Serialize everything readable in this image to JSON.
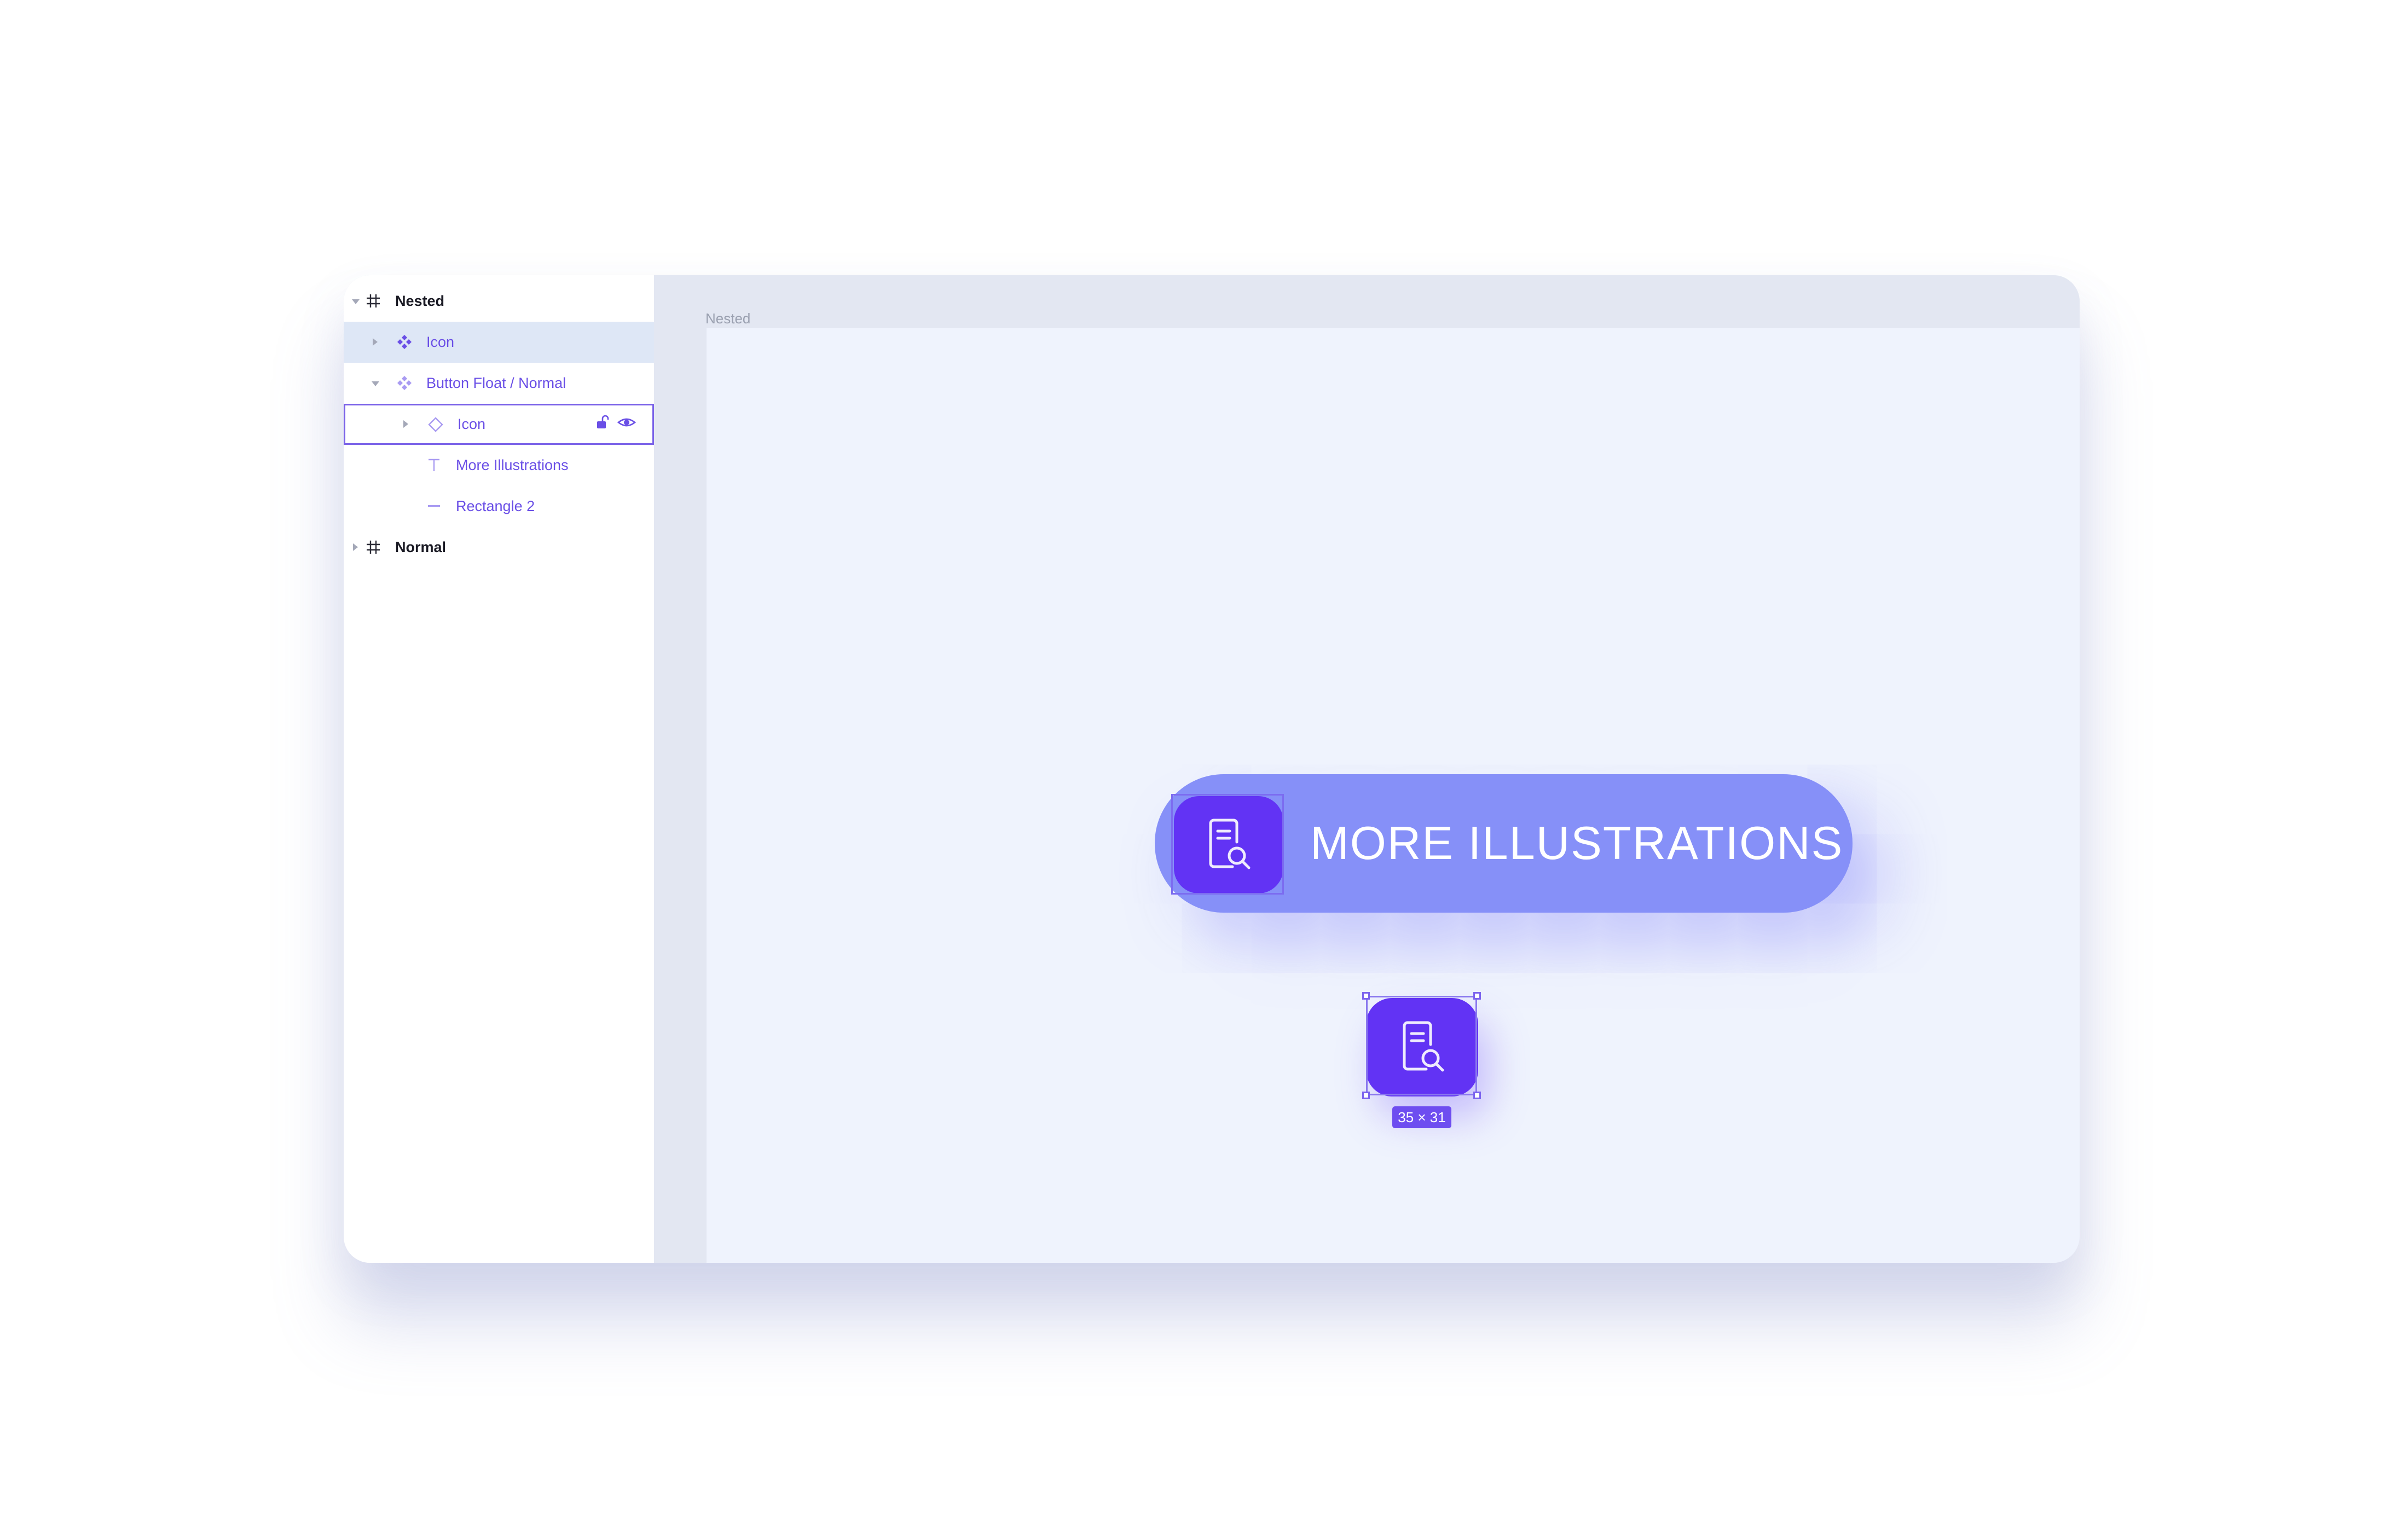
{
  "layers": {
    "nested": {
      "label": "Nested"
    },
    "icon_component": {
      "label": "Icon"
    },
    "button_float": {
      "label": "Button Float / Normal"
    },
    "icon_instance": {
      "label": "Icon"
    },
    "more_illustrations": {
      "label": "More Illustrations"
    },
    "rectangle": {
      "label": "Rectangle 2"
    },
    "normal": {
      "label": "Normal"
    }
  },
  "canvas": {
    "frame_title": "Nested",
    "button_text": "MORE ILLUSTRATIONS",
    "selection_size": "35 × 31"
  },
  "colors": {
    "accent": "#6233f4",
    "button_bg": "#8690f8",
    "layer_text": "#6a4fe6",
    "highlight_row": "#dee7f6",
    "canvas_bg": "#eff3fd"
  },
  "icons": [
    "frame-icon",
    "component-icon",
    "instance-icon",
    "text-icon",
    "rectangle-icon",
    "lock-icon",
    "eye-icon",
    "document-search-icon"
  ]
}
